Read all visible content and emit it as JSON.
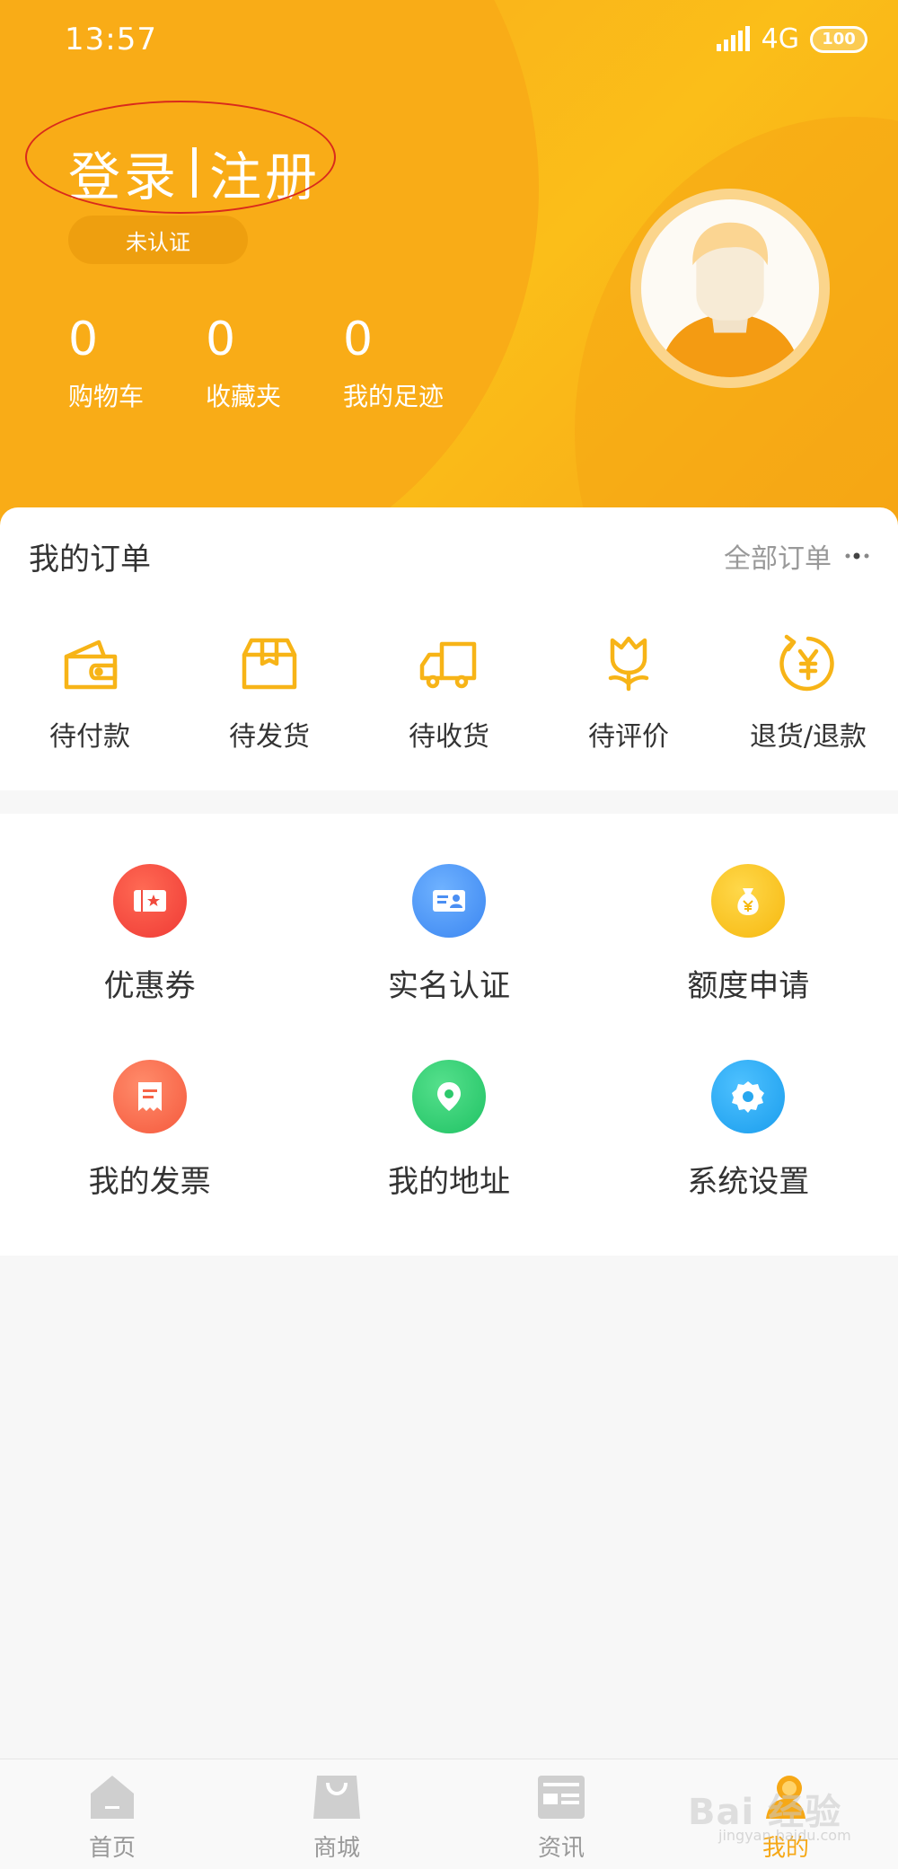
{
  "status_bar": {
    "time": "13:57",
    "network": "4G",
    "battery": "100"
  },
  "profile": {
    "login_label": "登录",
    "register_label": "注册",
    "cert_badge": "未认证",
    "stats": [
      {
        "value": "0",
        "label": "购物车"
      },
      {
        "value": "0",
        "label": "收藏夹"
      },
      {
        "value": "0",
        "label": "我的足迹"
      }
    ]
  },
  "orders": {
    "title": "我的订单",
    "all_orders_label": "全部订单",
    "items": [
      {
        "label": "待付款",
        "icon": "wallet-icon"
      },
      {
        "label": "待发货",
        "icon": "box-icon"
      },
      {
        "label": "待收货",
        "icon": "truck-icon"
      },
      {
        "label": "待评价",
        "icon": "flower-icon"
      },
      {
        "label": "退货/退款",
        "icon": "refund-icon"
      }
    ]
  },
  "services": [
    {
      "label": "优惠券",
      "icon": "coupon-icon",
      "color": "#f5473e"
    },
    {
      "label": "实名认证",
      "icon": "id-card-icon",
      "color": "#3f8ef5"
    },
    {
      "label": "额度申请",
      "icon": "money-bag-icon",
      "color": "#f8be12"
    },
    {
      "label": "我的发票",
      "icon": "invoice-icon",
      "color": "#f86a4a"
    },
    {
      "label": "我的地址",
      "icon": "location-pin-icon",
      "color": "#2fcf6e"
    },
    {
      "label": "系统设置",
      "icon": "gear-icon",
      "color": "#22a8ef"
    }
  ],
  "nav": [
    {
      "label": "首页",
      "icon": "home-icon",
      "active": false
    },
    {
      "label": "商城",
      "icon": "shopping-bag-icon",
      "active": false
    },
    {
      "label": "资讯",
      "icon": "news-icon",
      "active": false
    },
    {
      "label": "我的",
      "icon": "profile-icon",
      "active": true
    }
  ],
  "watermark": {
    "text": "Bai 经验",
    "sub": "jingyan.baidu.com"
  },
  "colors": {
    "accent": "#f6a816",
    "header": "#fbbe19"
  }
}
